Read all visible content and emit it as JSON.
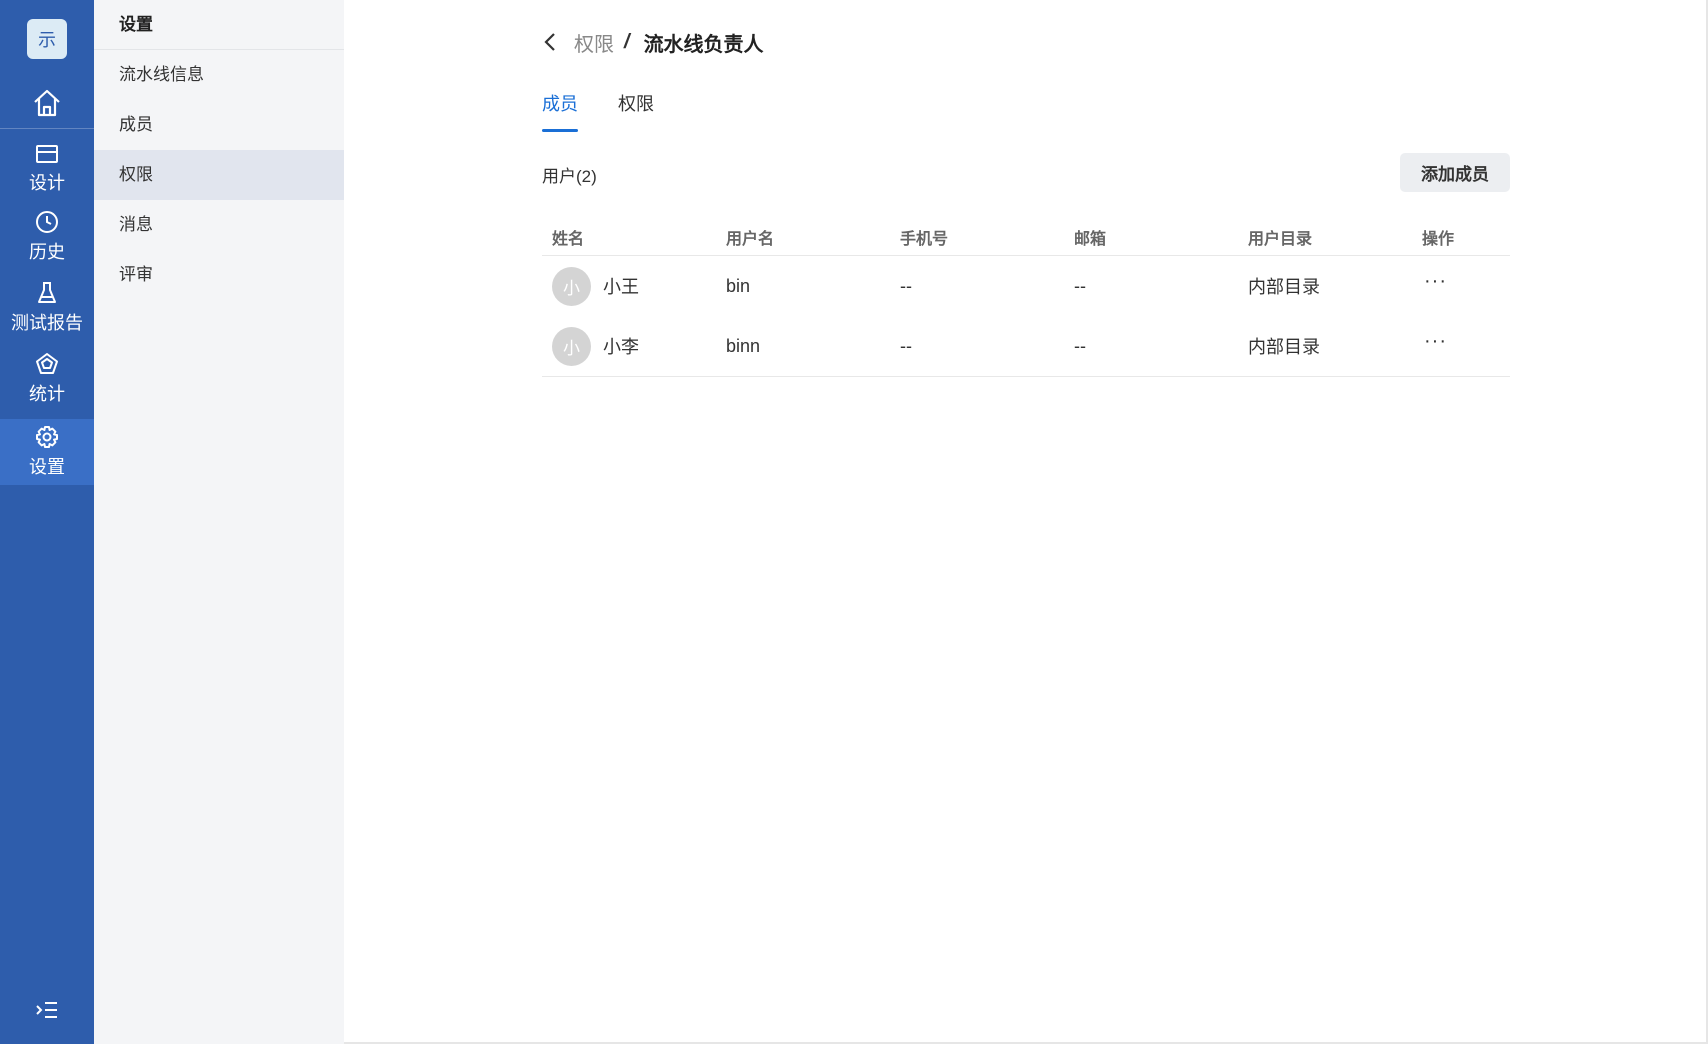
{
  "rail": {
    "logo_text": "示",
    "items": [
      {
        "label": "设计",
        "icon": "card-icon"
      },
      {
        "label": "历史",
        "icon": "clock-icon"
      },
      {
        "label": "测试报告",
        "icon": "flask-icon"
      },
      {
        "label": "统计",
        "icon": "pentagon-icon"
      },
      {
        "label": "设置",
        "icon": "gear-icon"
      }
    ],
    "active_index": 4,
    "accent_color": "#2e5dac"
  },
  "subnav": {
    "title": "设置",
    "items": [
      {
        "label": "流水线信息"
      },
      {
        "label": "成员"
      },
      {
        "label": "权限"
      },
      {
        "label": "消息"
      },
      {
        "label": "评审"
      }
    ],
    "active_index": 2
  },
  "breadcrumb": {
    "parent": "权限",
    "separator": "/",
    "current": "流水线负责人"
  },
  "tabs": [
    {
      "label": "成员",
      "active": true
    },
    {
      "label": "权限",
      "active": false
    }
  ],
  "users": {
    "title": "用户(2)",
    "add_button": "添加成员",
    "columns": [
      "姓名",
      "用户名",
      "手机号",
      "邮箱",
      "用户目录",
      "操作"
    ],
    "rows": [
      {
        "avatar": "小",
        "name": "小王",
        "username": "bin",
        "phone": "--",
        "email": "--",
        "directory": "内部目录",
        "action": "···"
      },
      {
        "avatar": "小",
        "name": "小李",
        "username": "binn",
        "phone": "--",
        "email": "--",
        "directory": "内部目录",
        "action": "···"
      }
    ]
  },
  "tab_accent": "#1a6fd6"
}
